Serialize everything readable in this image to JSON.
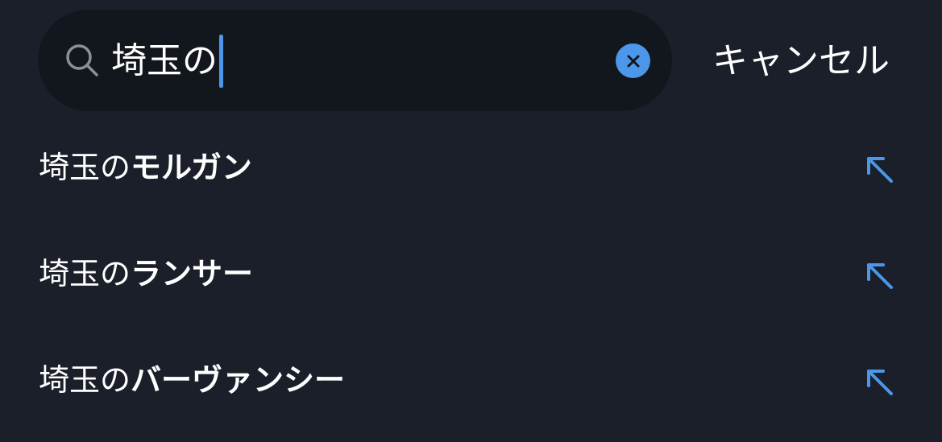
{
  "search": {
    "query": "埼玉の",
    "icon": "search-icon",
    "clear_icon": "close-icon"
  },
  "cancel_label": "キャンセル",
  "suggestions": [
    {
      "prefix": "埼玉の",
      "suffix": "モルガン",
      "icon": "arrow-up-left-icon"
    },
    {
      "prefix": "埼玉の",
      "suffix": "ランサー",
      "icon": "arrow-up-left-icon"
    },
    {
      "prefix": "埼玉の",
      "suffix": "バーヴァンシー",
      "icon": "arrow-up-left-icon"
    }
  ],
  "colors": {
    "background": "#1a1f29",
    "search_field": "#12161d",
    "accent": "#4c97ea",
    "text": "#ffffff",
    "icon_muted": "#8a9099"
  }
}
